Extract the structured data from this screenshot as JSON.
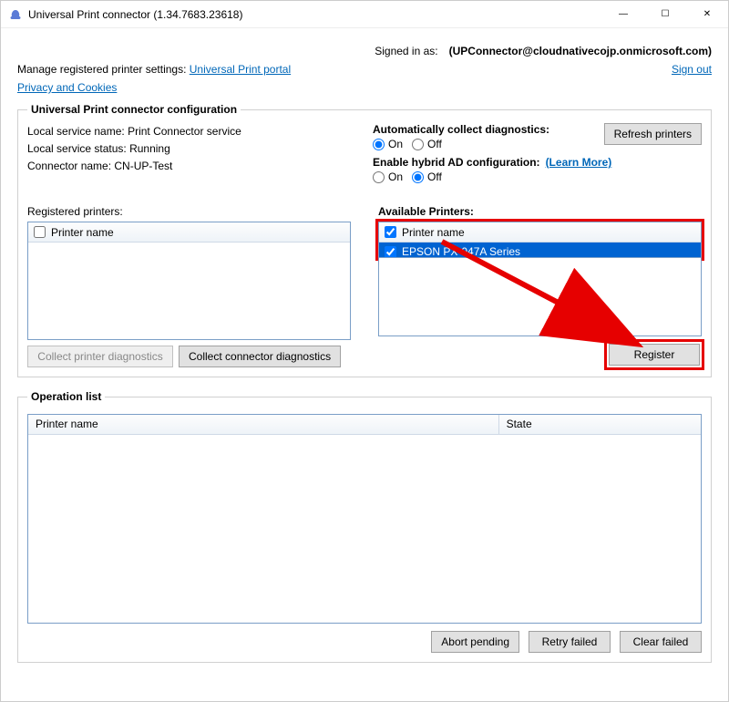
{
  "window": {
    "title": "Universal Print connector (1.34.7683.23618)",
    "minimize_glyph": "—",
    "maximize_glyph": "☐",
    "close_glyph": "✕"
  },
  "signin": {
    "label": "Signed in as:",
    "email": "(UPConnector@cloudnativecojp.onmicrosoft.com)",
    "signout": "Sign out"
  },
  "links": {
    "manage_text": "Manage registered printer settings: ",
    "portal": "Universal Print portal",
    "privacy": "Privacy and Cookies"
  },
  "config": {
    "legend": "Universal Print connector configuration",
    "service_name_label": "Local service name: ",
    "service_name_value": "Print Connector service",
    "service_status_label": "Local service status: ",
    "service_status_value": "Running",
    "connector_name_label": "Connector name: ",
    "connector_name_value": "CN-UP-Test",
    "auto_diag_label": "Automatically collect diagnostics:",
    "on": "On",
    "off": "Off",
    "hybrid_label": "Enable hybrid AD configuration:",
    "learn_more": "(Learn More)",
    "refresh": "Refresh printers"
  },
  "registered": {
    "label": "Registered printers:",
    "header": "Printer name",
    "collect_printer": "Collect printer diagnostics",
    "collect_connector": "Collect connector diagnostics"
  },
  "available": {
    "label": "Available Printers:",
    "header": "Printer name",
    "items": [
      {
        "name": "EPSON PX-047A Series",
        "checked": true
      }
    ],
    "register": "Register"
  },
  "oplist": {
    "legend": "Operation list",
    "col_name": "Printer name",
    "col_state": "State",
    "abort": "Abort pending",
    "retry": "Retry failed",
    "clear": "Clear failed"
  }
}
